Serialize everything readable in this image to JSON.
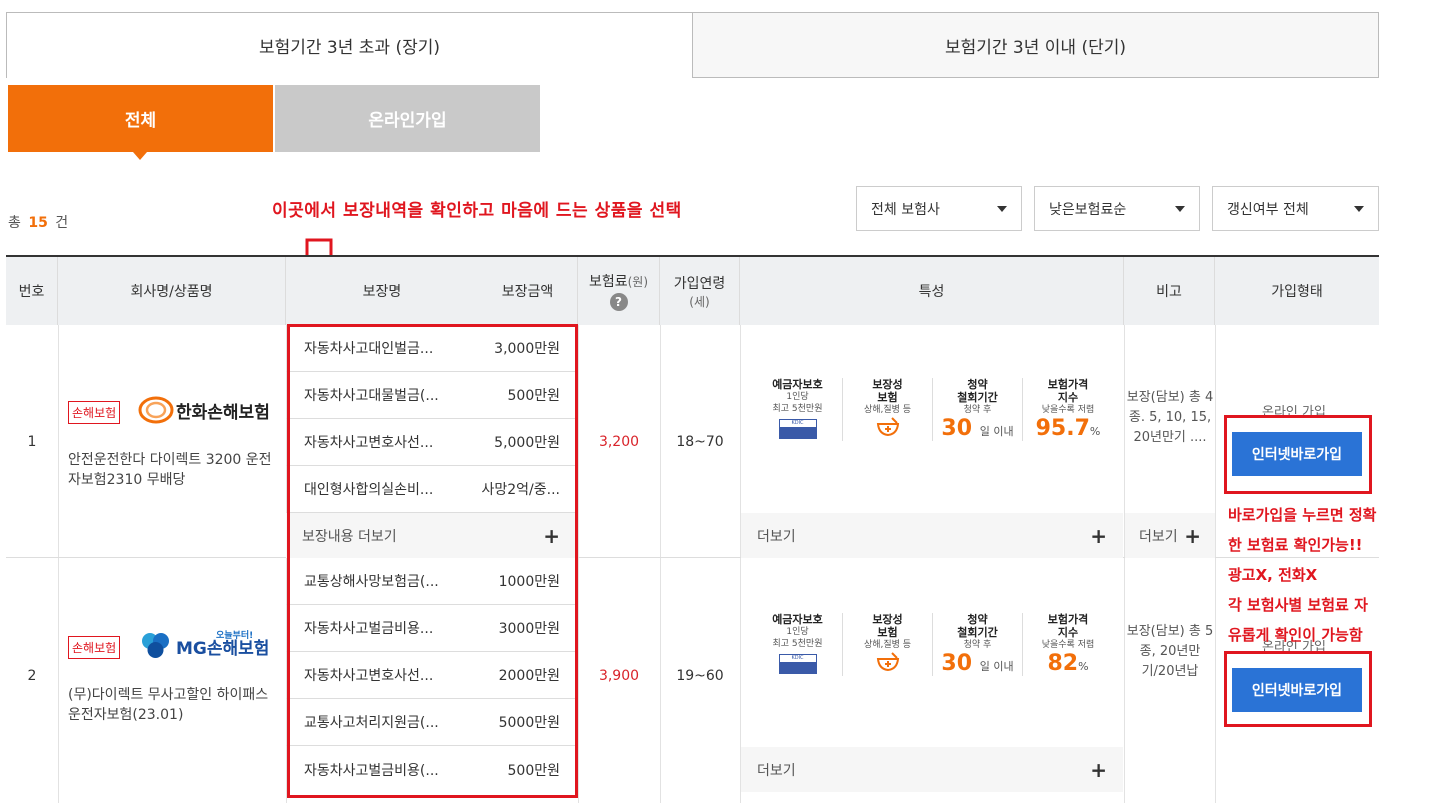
{
  "tabs": {
    "long_term": "보험기간 3년 초과 (장기)",
    "short_term": "보험기간 3년 이내 (단기)"
  },
  "subtabs": {
    "all": "전체",
    "online": "온라인가입"
  },
  "count": {
    "prefix": "총",
    "value": "15",
    "suffix": "건"
  },
  "annotation_top": "이곳에서 보장내역을 확인하고 마음에 드는 상품을 선택",
  "annotation_side": [
    "바로가입을 누르면 정확",
    "한 보험료 확인가능!!",
    "광고X, 전화X",
    "각 보험사별 보험료 자",
    "유롭게 확인이 가능함"
  ],
  "filters": {
    "insurer": "전체 보험사",
    "sort": "낮은보험료순",
    "renewal": "갱신여부 전체"
  },
  "table_headers": {
    "no": "번호",
    "company": "회사명/상품명",
    "coverage_name": "보장명",
    "coverage_amount": "보장금액",
    "premium": "보험료",
    "premium_unit": "(원)",
    "age": "가입연령",
    "age_unit": "(세)",
    "features": "특성",
    "note": "비고",
    "join_type": "가입형태"
  },
  "feature_labels": {
    "deposit_title": "예금자보호",
    "deposit_sub1": "1인당",
    "deposit_sub2": "최고 5천만원",
    "guarantee_title1": "보장성",
    "guarantee_title2": "보험",
    "guarantee_sub": "상해,질병 등",
    "withdraw_title1": "청약",
    "withdraw_title2": "철회기간",
    "withdraw_sub": "청약 후",
    "withdraw_value": "30",
    "withdraw_unit": "일 이내",
    "index_title1": "보험가격",
    "index_title2": "지수",
    "index_sub": "낮을수록 저렴",
    "index_unit": "%"
  },
  "more_label": "더보기",
  "coverage_more_label": "보장내용 더보기",
  "rows": [
    {
      "no": "1",
      "badge": "손해보험",
      "company": "한화손해보험",
      "product": "안전운전한다 다이렉트 3200 운전자보험2310 무배당",
      "coverages": [
        {
          "name": "자동차사고대인벌금...",
          "amount": "3,000만원"
        },
        {
          "name": "자동차사고대물벌금(...",
          "amount": "500만원"
        },
        {
          "name": "자동차사고변호사선...",
          "amount": "5,000만원"
        },
        {
          "name": "대인형사합의실손비...",
          "amount": "사망2억/중..."
        }
      ],
      "premium": "3,200",
      "age": "18~70",
      "price_index": "95.7",
      "note": "보장(담보) 총 4종. 5, 10, 15, 20년만기 ....",
      "note_more": "더보기",
      "join_type": "온라인 가입",
      "join_button": "인터넷바로가입"
    },
    {
      "no": "2",
      "badge": "손해보험",
      "company": "MG손해보험",
      "company_tagline": "오늘부터!",
      "product": "(무)다이렉트 무사고할인 하이패스 운전자보험(23.01)",
      "coverages": [
        {
          "name": "교통상해사망보험금(...",
          "amount": "1000만원"
        },
        {
          "name": "자동차사고벌금비용...",
          "amount": "3000만원"
        },
        {
          "name": "자동차사고변호사선...",
          "amount": "2000만원"
        },
        {
          "name": "교통사고처리지원금(...",
          "amount": "5000만원"
        },
        {
          "name": "자동차사고벌금비용(...",
          "amount": "500만원"
        }
      ],
      "premium": "3,900",
      "age": "19~60",
      "price_index": "82",
      "note": "보장(담보) 총 5종, 20년만기/20년납",
      "join_type": "온라인 가입",
      "join_button": "인터넷바로가입"
    }
  ],
  "colors": {
    "accent": "#f26f0a",
    "annotation": "#e0161f",
    "button": "#2a73d6"
  }
}
